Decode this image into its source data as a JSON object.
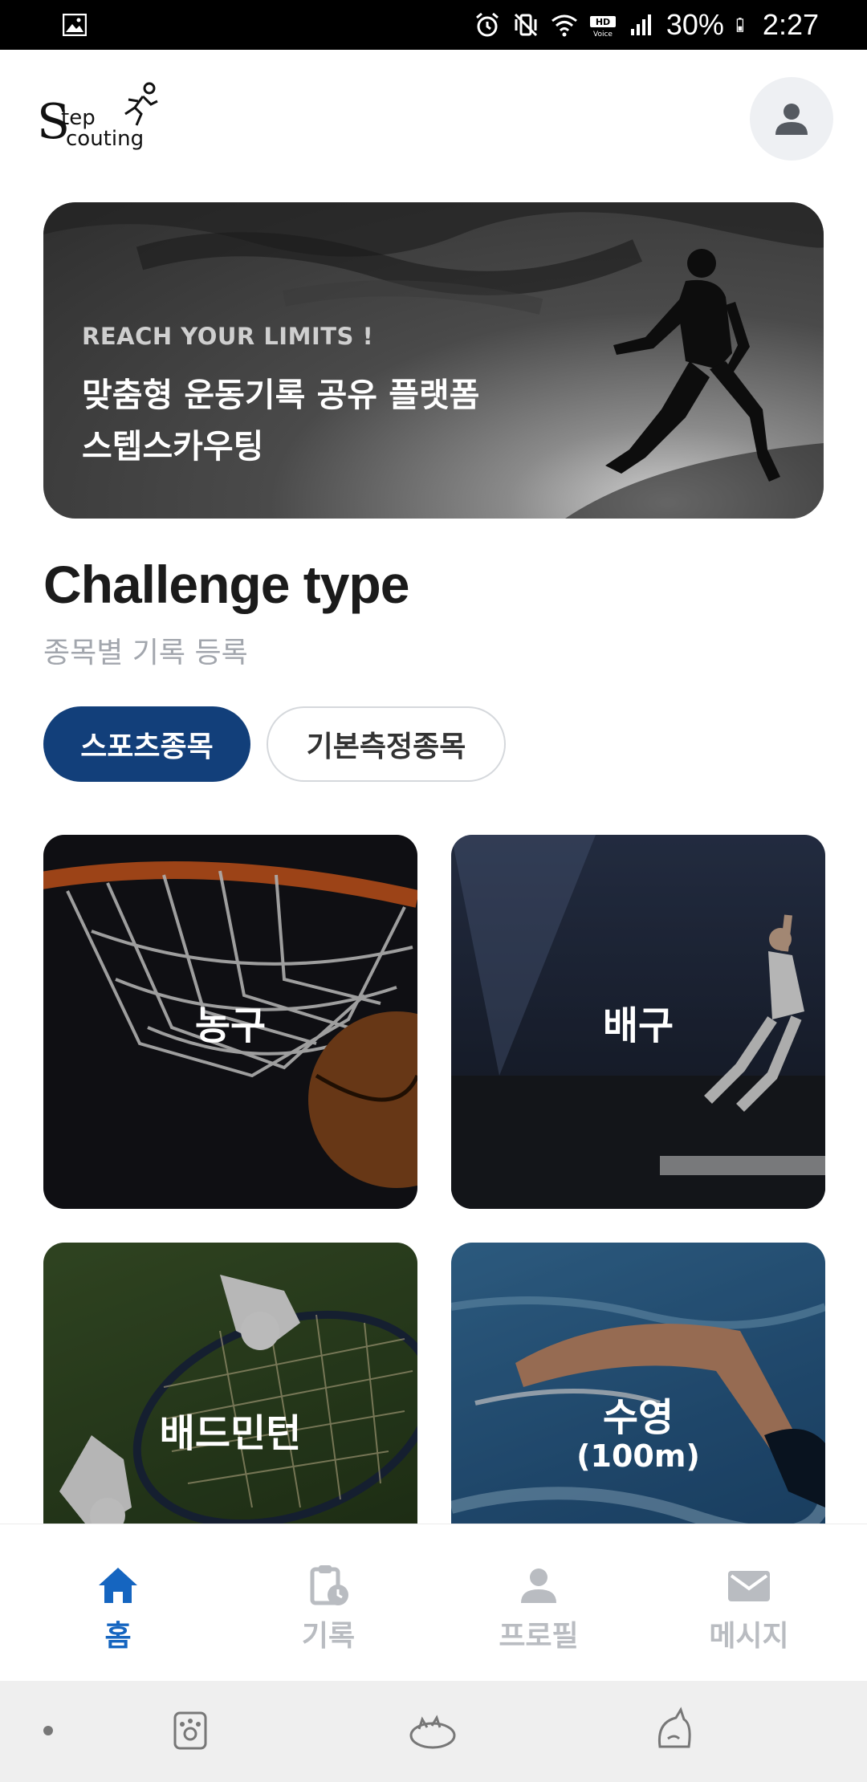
{
  "status_bar": {
    "battery": "30%",
    "time": "2:27"
  },
  "header": {
    "logo_s": "S",
    "logo_top": "tep",
    "logo_bottom": "couting"
  },
  "banner": {
    "subtitle": "REACH YOUR LIMITS !",
    "title_line1": "맞춤형 운동기록 공유 플랫폼",
    "title_line2": "스텝스카우팅"
  },
  "section": {
    "title": "Challenge type",
    "subtitle": "종목별 기록 등록"
  },
  "chips": [
    {
      "label": "스포츠종목",
      "active": true
    },
    {
      "label": "기본측정종목",
      "active": false
    }
  ],
  "cards": [
    {
      "label": "농구"
    },
    {
      "label": "배구"
    },
    {
      "label": "배드민턴"
    },
    {
      "label": "수영",
      "sublabel": "(100m)"
    }
  ],
  "bottom_nav": [
    {
      "label": "홈",
      "icon": "home-icon",
      "active": true
    },
    {
      "label": "기록",
      "icon": "clipboard-clock-icon",
      "active": false
    },
    {
      "label": "프로필",
      "icon": "person-icon",
      "active": false
    },
    {
      "label": "메시지",
      "icon": "mail-icon",
      "active": false
    }
  ],
  "colors": {
    "primary": "#123f7a",
    "nav_active": "#1565c0",
    "nav_inactive": "#b9bcc1",
    "muted_text": "#a2a6ad"
  }
}
